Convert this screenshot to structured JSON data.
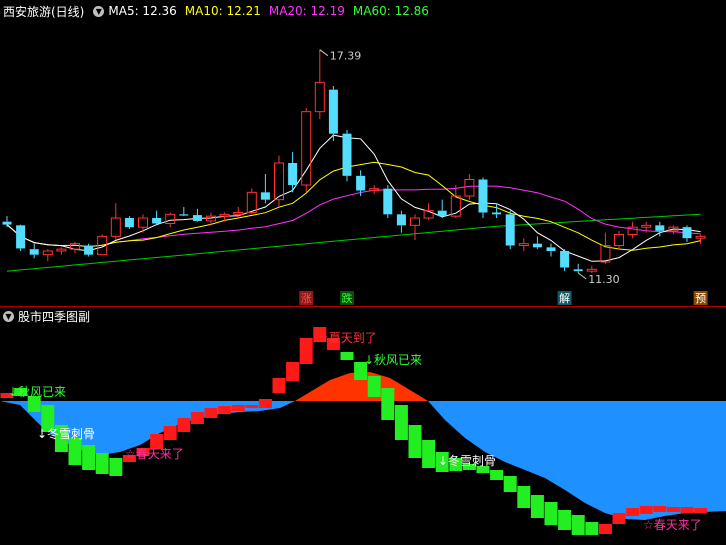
{
  "top_panel": {
    "title": "西安旅游(日线)",
    "ma": [
      {
        "label": "MA5: 12.36",
        "color": "#ffffff"
      },
      {
        "label": "MA10: 12.21",
        "color": "#ffff00"
      },
      {
        "label": "MA20: 12.19",
        "color": "#ff00ff"
      },
      {
        "label": "MA60: 12.86",
        "color": "#00ff00"
      }
    ],
    "high_label": "17.39",
    "low_label": "11.30",
    "markers": [
      {
        "text": "涨",
        "bg": "#8b1a1a",
        "color": "#ff5050"
      },
      {
        "text": "跌",
        "bg": "#0a4d0a",
        "color": "#33ff33"
      },
      {
        "text": "解",
        "bg": "#0f5a66",
        "color": "#ffffff"
      },
      {
        "text": "预",
        "bg": "#8a4a00",
        "color": "#ffffff"
      }
    ]
  },
  "bottom_panel": {
    "title": "股市四季图副",
    "annotations": [
      {
        "text": "秋风已来",
        "color": "#33ff33"
      },
      {
        "text": "冬雪刺骨",
        "color": "#ffffff"
      },
      {
        "text": "春天来了",
        "color": "#ff3399"
      },
      {
        "text": "夏天到了",
        "color": "#ff3333"
      },
      {
        "text": "秋风已来",
        "color": "#33ff33"
      },
      {
        "text": "冬雪刺骨",
        "color": "#ffffff"
      },
      {
        "text": "春天来了",
        "color": "#ff3399"
      }
    ]
  },
  "colors": {
    "up": "#ff3333",
    "down": "#55ddff",
    "ma60": "#00cc00",
    "area_pos": "#ff3300",
    "area_neg": "#1e90ff",
    "bar_red": "#ff1a1a",
    "bar_green": "#22ee22"
  },
  "chart_data": [
    {
      "type": "candlestick",
      "title": "西安旅游(日线)",
      "note": "approximate daily OHLC read from price panel",
      "ohlc": [
        [
          12.7,
          12.85,
          12.55,
          12.62
        ],
        [
          12.6,
          12.62,
          11.9,
          11.97
        ],
        [
          11.95,
          12.1,
          11.7,
          11.8
        ],
        [
          11.8,
          11.95,
          11.62,
          11.9
        ],
        [
          11.9,
          12.0,
          11.8,
          11.95
        ],
        [
          11.95,
          12.15,
          11.85,
          12.1
        ],
        [
          12.05,
          12.1,
          11.75,
          11.8
        ],
        [
          11.8,
          12.35,
          11.8,
          12.3
        ],
        [
          12.3,
          13.2,
          12.2,
          12.8
        ],
        [
          12.8,
          12.85,
          12.5,
          12.55
        ],
        [
          12.55,
          12.9,
          12.4,
          12.8
        ],
        [
          12.8,
          13.0,
          12.6,
          12.65
        ],
        [
          12.65,
          12.95,
          12.55,
          12.9
        ],
        [
          12.9,
          13.1,
          12.85,
          12.88
        ],
        [
          12.88,
          13.05,
          12.7,
          12.72
        ],
        [
          12.72,
          12.95,
          12.6,
          12.85
        ],
        [
          12.85,
          12.95,
          12.7,
          12.9
        ],
        [
          12.9,
          13.1,
          12.8,
          12.95
        ],
        [
          12.95,
          13.6,
          12.9,
          13.5
        ],
        [
          13.5,
          14.0,
          13.2,
          13.3
        ],
        [
          13.3,
          14.5,
          13.1,
          14.3
        ],
        [
          14.3,
          14.6,
          13.5,
          13.7
        ],
        [
          13.7,
          15.8,
          13.5,
          15.7
        ],
        [
          15.7,
          17.39,
          15.5,
          16.5
        ],
        [
          16.3,
          16.4,
          14.9,
          15.1
        ],
        [
          15.1,
          15.2,
          13.8,
          13.95
        ],
        [
          13.95,
          14.1,
          13.4,
          13.55
        ],
        [
          13.55,
          13.7,
          13.45,
          13.6
        ],
        [
          13.6,
          13.7,
          12.8,
          12.9
        ],
        [
          12.9,
          13.0,
          12.4,
          12.6
        ],
        [
          12.6,
          12.9,
          12.2,
          12.8
        ],
        [
          12.8,
          13.2,
          12.75,
          13.0
        ],
        [
          13.0,
          13.3,
          12.8,
          12.85
        ],
        [
          12.85,
          13.7,
          12.8,
          13.4
        ],
        [
          13.4,
          14.0,
          13.3,
          13.85
        ],
        [
          13.85,
          13.9,
          12.8,
          12.95
        ],
        [
          12.95,
          13.2,
          12.8,
          12.9
        ],
        [
          12.9,
          13.0,
          11.95,
          12.05
        ],
        [
          12.05,
          12.25,
          11.9,
          12.1
        ],
        [
          12.1,
          12.3,
          11.95,
          12.0
        ],
        [
          12.0,
          12.1,
          11.75,
          11.9
        ],
        [
          11.9,
          11.95,
          11.35,
          11.45
        ],
        [
          11.4,
          11.55,
          11.3,
          11.35
        ],
        [
          11.35,
          11.5,
          11.3,
          11.4
        ],
        [
          11.6,
          12.4,
          11.55,
          12.05
        ],
        [
          12.05,
          12.45,
          11.95,
          12.35
        ],
        [
          12.35,
          12.7,
          12.25,
          12.55
        ],
        [
          12.55,
          12.7,
          12.4,
          12.6
        ],
        [
          12.6,
          12.7,
          12.3,
          12.45
        ],
        [
          12.45,
          12.6,
          12.35,
          12.55
        ],
        [
          12.55,
          12.6,
          12.15,
          12.25
        ],
        [
          12.25,
          12.35,
          12.1,
          12.3
        ]
      ],
      "annotations": {
        "max": 17.39,
        "min": 11.3
      },
      "ylim": [
        10.7,
        18.2
      ]
    },
    {
      "type": "bar",
      "title": "股市四季图副",
      "note": "oscillator bars (red rising, green falling) with filled area around zero",
      "bars": [
        {
          "x": 0,
          "top": 393,
          "bot": 398,
          "c": "r"
        },
        {
          "x": 1,
          "top": 388,
          "bot": 396,
          "c": "g"
        },
        {
          "x": 2,
          "top": 396,
          "bot": 412,
          "c": "g"
        },
        {
          "x": 3,
          "top": 405,
          "bot": 432,
          "c": "g"
        },
        {
          "x": 4,
          "top": 425,
          "bot": 452,
          "c": "g"
        },
        {
          "x": 5,
          "top": 438,
          "bot": 465,
          "c": "g"
        },
        {
          "x": 6,
          "top": 445,
          "bot": 470,
          "c": "g"
        },
        {
          "x": 7,
          "top": 453,
          "bot": 474,
          "c": "g"
        },
        {
          "x": 8,
          "top": 458,
          "bot": 476,
          "c": "g"
        },
        {
          "x": 9,
          "top": 455,
          "bot": 462,
          "c": "r"
        },
        {
          "x": 10,
          "top": 448,
          "bot": 456,
          "c": "r"
        },
        {
          "x": 11,
          "top": 434,
          "bot": 449,
          "c": "r"
        },
        {
          "x": 12,
          "top": 426,
          "bot": 440,
          "c": "r"
        },
        {
          "x": 13,
          "top": 418,
          "bot": 432,
          "c": "r"
        },
        {
          "x": 14,
          "top": 412,
          "bot": 424,
          "c": "r"
        },
        {
          "x": 15,
          "top": 408,
          "bot": 418,
          "c": "r"
        },
        {
          "x": 16,
          "top": 406,
          "bot": 414,
          "c": "r"
        },
        {
          "x": 17,
          "top": 405,
          "bot": 411,
          "c": "r"
        },
        {
          "x": 18,
          "top": 405,
          "bot": 408,
          "c": "r"
        },
        {
          "x": 19,
          "top": 399,
          "bot": 408,
          "c": "r"
        },
        {
          "x": 20,
          "top": 378,
          "bot": 393,
          "c": "r"
        },
        {
          "x": 21,
          "top": 362,
          "bot": 381,
          "c": "r"
        },
        {
          "x": 22,
          "top": 338,
          "bot": 364,
          "c": "r"
        },
        {
          "x": 23,
          "top": 327,
          "bot": 342,
          "c": "r"
        },
        {
          "x": 24,
          "top": 338,
          "bot": 350,
          "c": "r"
        },
        {
          "x": 25,
          "top": 352,
          "bot": 360,
          "c": "g"
        },
        {
          "x": 26,
          "top": 362,
          "bot": 380,
          "c": "g"
        },
        {
          "x": 27,
          "top": 376,
          "bot": 397,
          "c": "g"
        },
        {
          "x": 28,
          "top": 388,
          "bot": 420,
          "c": "g"
        },
        {
          "x": 29,
          "top": 405,
          "bot": 440,
          "c": "g"
        },
        {
          "x": 30,
          "top": 425,
          "bot": 458,
          "c": "g"
        },
        {
          "x": 31,
          "top": 440,
          "bot": 468,
          "c": "g"
        },
        {
          "x": 32,
          "top": 452,
          "bot": 472,
          "c": "g"
        },
        {
          "x": 33,
          "top": 458,
          "bot": 471,
          "c": "g"
        },
        {
          "x": 34,
          "top": 464,
          "bot": 470,
          "c": "g"
        },
        {
          "x": 35,
          "top": 466,
          "bot": 473,
          "c": "g"
        },
        {
          "x": 36,
          "top": 470,
          "bot": 480,
          "c": "g"
        },
        {
          "x": 37,
          "top": 476,
          "bot": 492,
          "c": "g"
        },
        {
          "x": 38,
          "top": 486,
          "bot": 508,
          "c": "g"
        },
        {
          "x": 39,
          "top": 495,
          "bot": 518,
          "c": "g"
        },
        {
          "x": 40,
          "top": 502,
          "bot": 525,
          "c": "g"
        },
        {
          "x": 41,
          "top": 510,
          "bot": 530,
          "c": "g"
        },
        {
          "x": 42,
          "top": 515,
          "bot": 535,
          "c": "g"
        },
        {
          "x": 43,
          "top": 522,
          "bot": 535,
          "c": "g"
        },
        {
          "x": 44,
          "top": 524,
          "bot": 534,
          "c": "r"
        },
        {
          "x": 45,
          "top": 513,
          "bot": 524,
          "c": "r"
        },
        {
          "x": 46,
          "top": 508,
          "bot": 516,
          "c": "r"
        },
        {
          "x": 47,
          "top": 506,
          "bot": 514,
          "c": "r"
        },
        {
          "x": 48,
          "top": 506,
          "bot": 512,
          "c": "r"
        },
        {
          "x": 49,
          "top": 507,
          "bot": 512,
          "c": "r"
        },
        {
          "x": 50,
          "top": 507,
          "bot": 513,
          "c": "r"
        },
        {
          "x": 51,
          "top": 508,
          "bot": 513,
          "c": "r"
        }
      ]
    }
  ]
}
